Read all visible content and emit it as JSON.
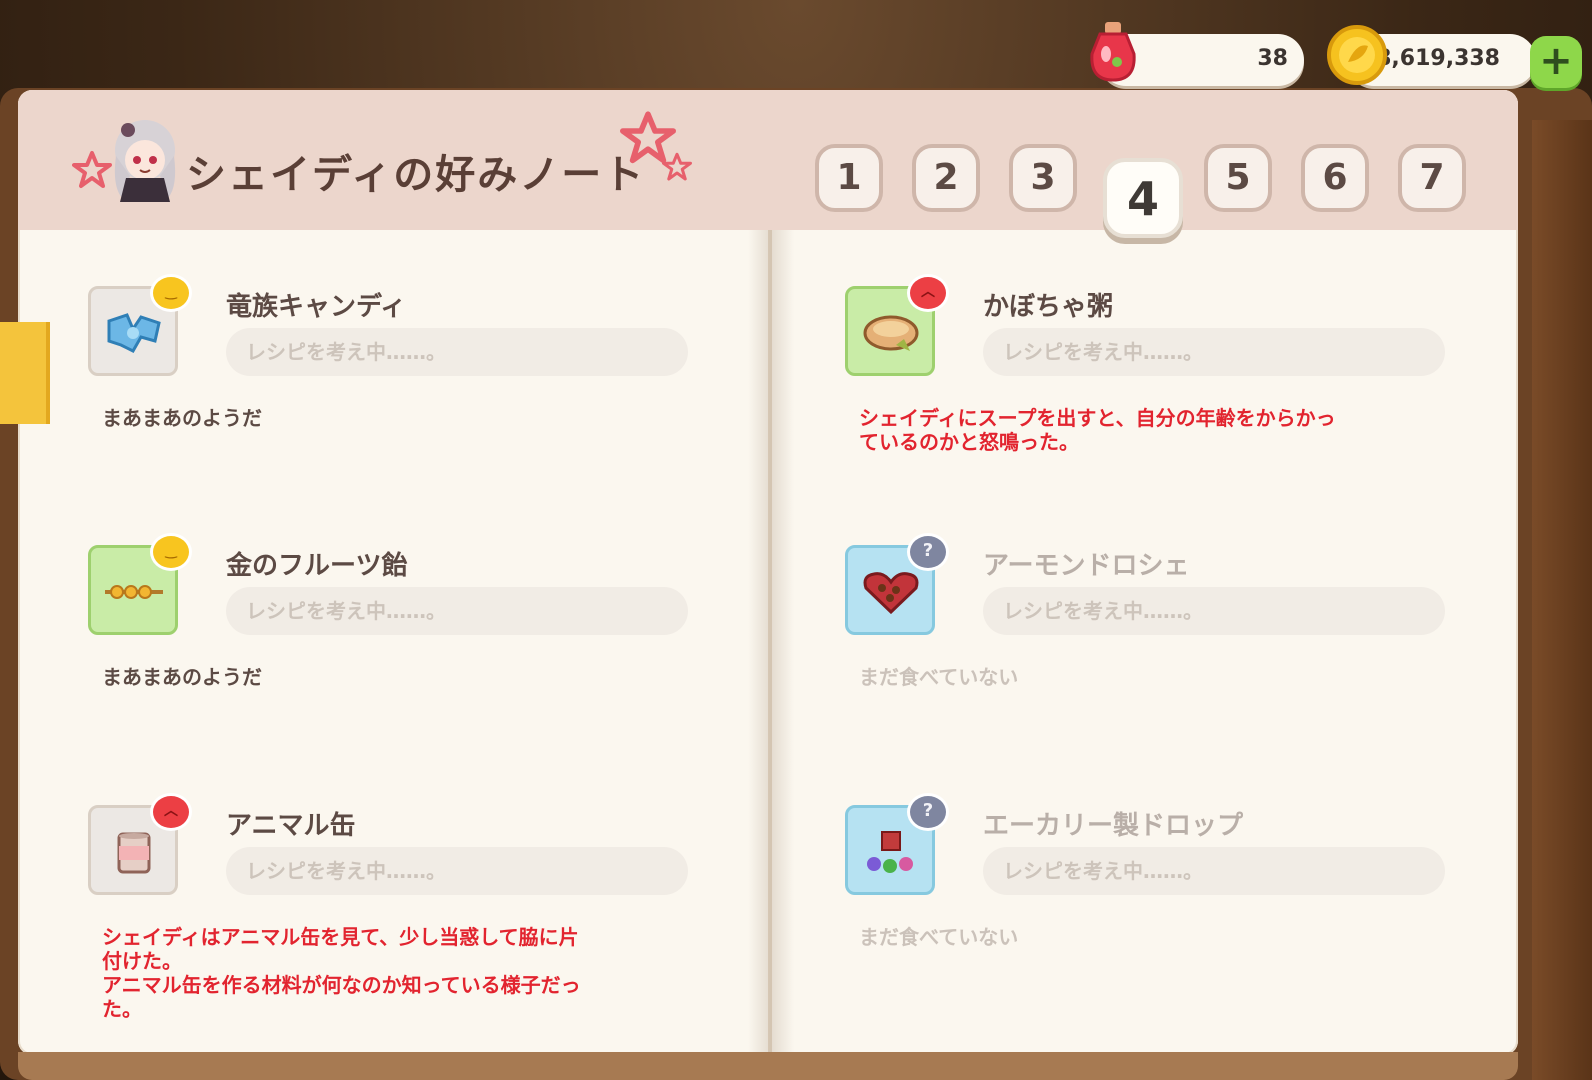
{
  "header": {
    "title": "シェイディの好みノート"
  },
  "currency": {
    "potion_count": "38",
    "coins": "8,619,338",
    "plus_label": "+"
  },
  "tabs": [
    "1",
    "2",
    "3",
    "4",
    "5",
    "6",
    "7"
  ],
  "active_tab": "4",
  "recipe_placeholder": "レシピを考え中……。",
  "entries": [
    {
      "name": "竜族キャンディ",
      "mood": "satisfied",
      "mood_color": "#f8c51f",
      "reaction_lines": [
        "まあまあのようだ"
      ]
    },
    {
      "name": "かぼちゃ粥",
      "mood": "angry",
      "mood_color": "#ec3f44",
      "reaction_lines": [
        "シェイディにスープを出すと、自分の年齢をからかっ",
        "ているのかと怒鳴った。"
      ]
    },
    {
      "name": "金のフルーツ飴",
      "mood": "satisfied",
      "mood_color": "#f8c51f",
      "reaction_lines": [
        "まあまあのようだ"
      ]
    },
    {
      "name": "アーモンドロシェ",
      "mood": "unknown",
      "mood_color": "#7f86a0",
      "mood_text": "?",
      "reaction_lines": [
        "まだ食べていない"
      ]
    },
    {
      "name": "アニマル缶",
      "mood": "angry",
      "mood_color": "#ec3f44",
      "reaction_lines": [
        "シェイディはアニマル缶を見て、少し当惑して脇に片",
        "付けた。",
        "アニマル缶を作る材料が何なのか知っている様子だっ",
        "た。"
      ]
    },
    {
      "name": "エーカリー製ドロップ",
      "mood": "unknown",
      "mood_color": "#7f86a0",
      "mood_text": "?",
      "reaction_lines": [
        "まだ食べていない"
      ]
    }
  ]
}
